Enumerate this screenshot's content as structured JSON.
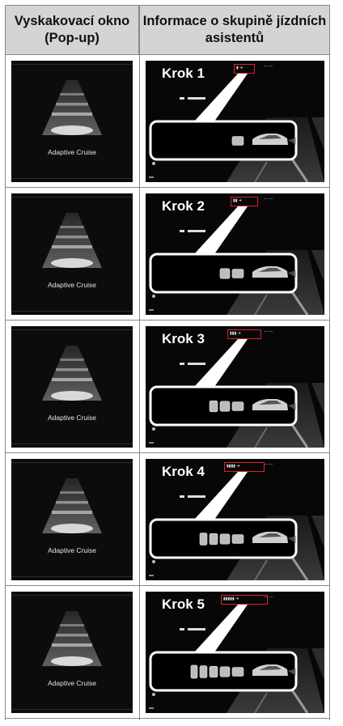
{
  "table": {
    "header_left": "Vyskakovací okno (Pop-up)",
    "header_right": "Informace o skupině jízdních asistentů"
  },
  "rows": [
    {
      "step_label": "Krok 1",
      "popup_caption": "Adaptive Cruise",
      "gap_bars": 1,
      "gap_bar_fraction": 0.2,
      "distance_text": "— —"
    },
    {
      "step_label": "Krok 2",
      "popup_caption": "Adaptive Cruise",
      "gap_bars": 2,
      "gap_bar_fraction": 0.4,
      "distance_text": "— —"
    },
    {
      "step_label": "Krok 3",
      "popup_caption": "Adaptive Cruise",
      "gap_bars": 3,
      "gap_bar_fraction": 0.6,
      "distance_text": "— —"
    },
    {
      "step_label": "Krok 4",
      "popup_caption": "Adaptive Cruise",
      "gap_bars": 4,
      "gap_bar_fraction": 0.8,
      "distance_text": "— —"
    },
    {
      "step_label": "Krok 5",
      "popup_caption": "Adaptive Cruise",
      "gap_bars": 5,
      "gap_bar_fraction": 1.0,
      "distance_text": "— —"
    }
  ],
  "colors": {
    "highlight": "#e0202a",
    "header_bg": "#d4d4d4",
    "screen_bg": "#0a0a0a"
  }
}
